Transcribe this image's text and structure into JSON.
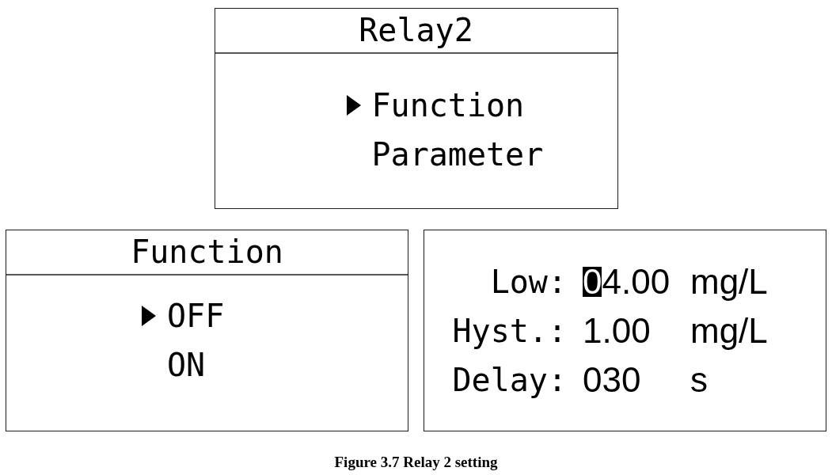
{
  "screens": [
    {
      "kind": "menu",
      "title": "Relay2",
      "items": [
        {
          "label": "Function",
          "selected": true
        },
        {
          "label": "Parameter",
          "selected": false
        }
      ]
    },
    {
      "kind": "menu",
      "title": "Function",
      "items": [
        {
          "label": "OFF",
          "selected": true
        },
        {
          "label": "ON",
          "selected": false
        }
      ]
    },
    {
      "kind": "parameters",
      "rows": [
        {
          "label": "Low:",
          "value_parts": [
            {
              "text": "0",
              "selected": true
            },
            {
              "text": "4.00",
              "selected": false
            }
          ],
          "unit": "mg/L"
        },
        {
          "label": "Hyst.:",
          "value_parts": [
            {
              "text": "1.00",
              "selected": false
            }
          ],
          "unit": "mg/L"
        },
        {
          "label": "Delay:",
          "value_parts": [
            {
              "text": "030",
              "selected": false
            }
          ],
          "unit": "s"
        }
      ]
    }
  ],
  "caption": "Figure 3.7 Relay 2 setting"
}
